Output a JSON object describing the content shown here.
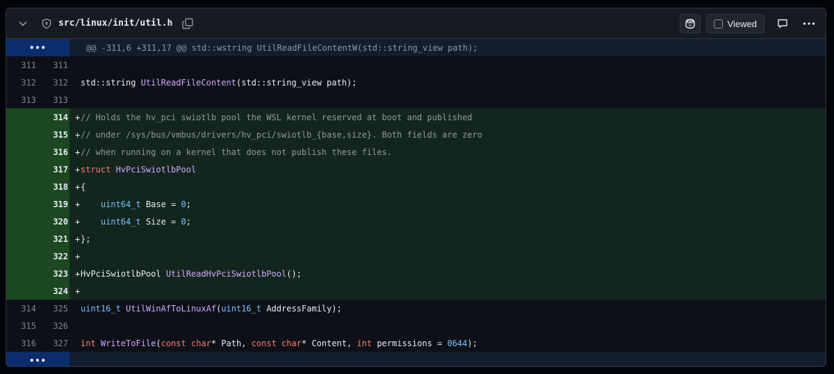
{
  "header": {
    "file_path": "src/linux/init/util.h",
    "viewed_label": "Viewed",
    "icons": [
      "chevron-down-icon",
      "shield-icon",
      "copy-icon",
      "copilot-icon",
      "checkbox-icon",
      "comment-icon",
      "kebab-icon"
    ]
  },
  "hunk_top": {
    "expand_label": "•••",
    "text": "@@ -311,6 +311,17 @@ std::wstring UtilReadFileContentW(std::string_view path);"
  },
  "hunk_bottom": {
    "expand_label": "•••"
  },
  "lines": [
    {
      "type": "ctx",
      "old": "311",
      "new": "311",
      "marker": "",
      "segments": []
    },
    {
      "type": "ctx",
      "old": "312",
      "new": "312",
      "marker": "",
      "segments": [
        [
          "",
          "std::string "
        ],
        [
          "fn",
          "UtilReadFileContent"
        ],
        [
          "",
          "(std::string_view path);"
        ]
      ]
    },
    {
      "type": "ctx",
      "old": "313",
      "new": "313",
      "marker": "",
      "segments": []
    },
    {
      "type": "add",
      "old": "",
      "new": "314",
      "marker": "+",
      "segments": [
        [
          "comment",
          "// Holds the hv_pci swiotlb pool the WSL kernel reserved at boot and published"
        ]
      ]
    },
    {
      "type": "add",
      "old": "",
      "new": "315",
      "marker": "+",
      "segments": [
        [
          "comment",
          "// under /sys/bus/vmbus/drivers/hv_pci/swiotlb_{base,size}. Both fields are zero"
        ]
      ]
    },
    {
      "type": "add",
      "old": "",
      "new": "316",
      "marker": "+",
      "segments": [
        [
          "comment",
          "// when running on a kernel that does not publish these files."
        ]
      ]
    },
    {
      "type": "add",
      "old": "",
      "new": "317",
      "marker": "+",
      "segments": [
        [
          "kw",
          "struct "
        ],
        [
          "fn",
          "HvPciSwiotlbPool"
        ]
      ]
    },
    {
      "type": "add",
      "old": "",
      "new": "318",
      "marker": "+",
      "segments": [
        [
          "",
          "{"
        ]
      ]
    },
    {
      "type": "add",
      "old": "",
      "new": "319",
      "marker": "+",
      "segments": [
        [
          "",
          "    "
        ],
        [
          "type",
          "uint64_t"
        ],
        [
          "",
          " Base = "
        ],
        [
          "num",
          "0"
        ],
        [
          "",
          ";"
        ]
      ]
    },
    {
      "type": "add",
      "old": "",
      "new": "320",
      "marker": "+",
      "segments": [
        [
          "",
          "    "
        ],
        [
          "type",
          "uint64_t"
        ],
        [
          "",
          " Size = "
        ],
        [
          "num",
          "0"
        ],
        [
          "",
          ";"
        ]
      ]
    },
    {
      "type": "add",
      "old": "",
      "new": "321",
      "marker": "+",
      "segments": [
        [
          "",
          "};"
        ]
      ]
    },
    {
      "type": "add",
      "old": "",
      "new": "322",
      "marker": "+",
      "segments": []
    },
    {
      "type": "add",
      "old": "",
      "new": "323",
      "marker": "+",
      "segments": [
        [
          "",
          "HvPciSwiotlbPool "
        ],
        [
          "fn",
          "UtilReadHvPciSwiotlbPool"
        ],
        [
          "",
          "();"
        ]
      ]
    },
    {
      "type": "add",
      "old": "",
      "new": "324",
      "marker": "+",
      "segments": []
    },
    {
      "type": "ctx",
      "old": "314",
      "new": "325",
      "marker": "",
      "segments": [
        [
          "type",
          "uint16_t"
        ],
        [
          "",
          " "
        ],
        [
          "fn",
          "UtilWinAfToLinuxAf"
        ],
        [
          "",
          "("
        ],
        [
          "type",
          "uint16_t"
        ],
        [
          "",
          " AddressFamily);"
        ]
      ]
    },
    {
      "type": "ctx",
      "old": "315",
      "new": "326",
      "marker": "",
      "segments": []
    },
    {
      "type": "ctx",
      "old": "316",
      "new": "327",
      "marker": "",
      "segments": [
        [
          "kw",
          "int "
        ],
        [
          "fn",
          "WriteToFile"
        ],
        [
          "",
          "("
        ],
        [
          "kw",
          "const char"
        ],
        [
          "",
          "* Path, "
        ],
        [
          "kw",
          "const char"
        ],
        [
          "",
          "* Content, "
        ],
        [
          "kw",
          "int"
        ],
        [
          "",
          " permissions = "
        ],
        [
          "num",
          "0644"
        ],
        [
          "",
          ");"
        ]
      ]
    }
  ]
}
